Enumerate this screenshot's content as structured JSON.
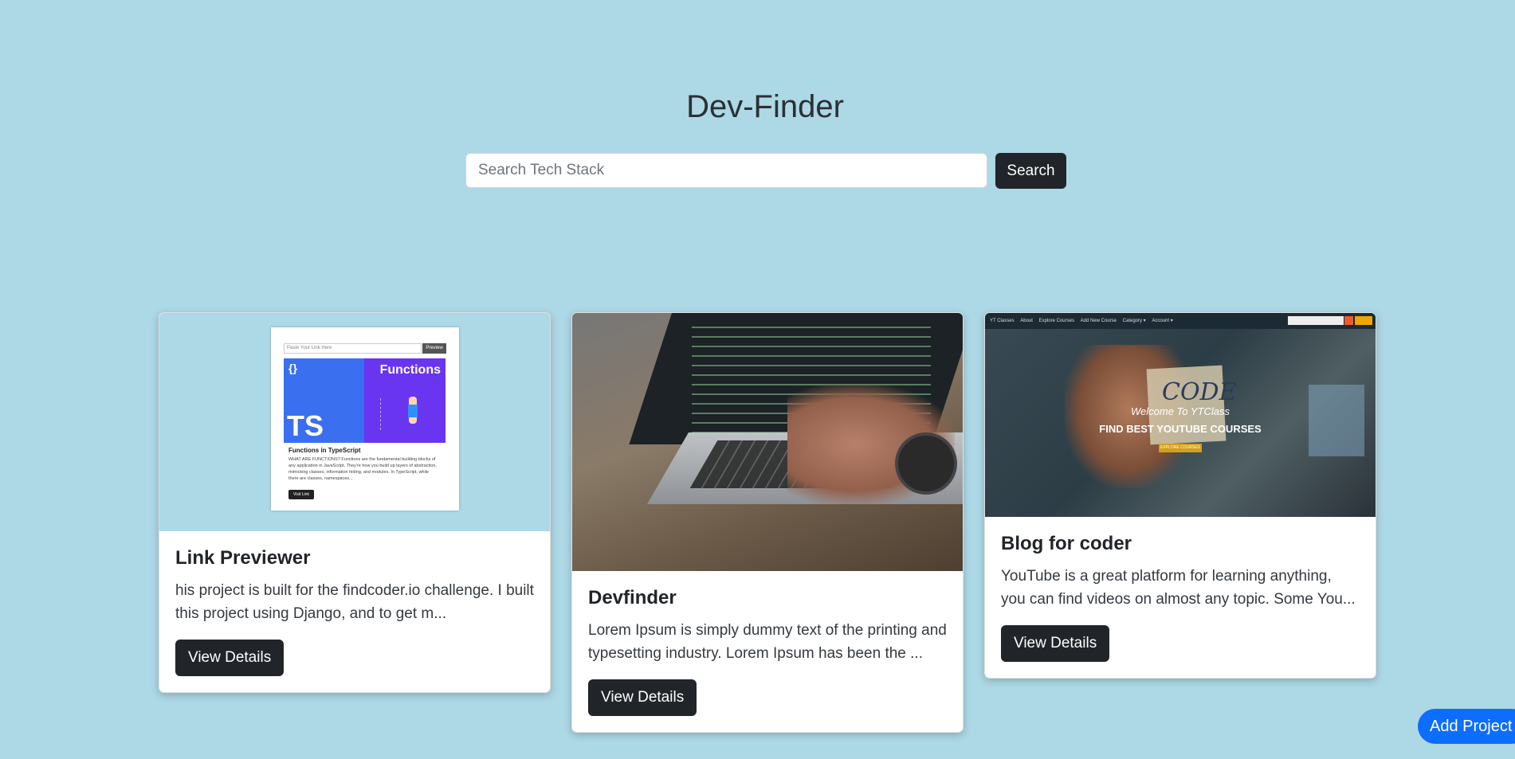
{
  "app": {
    "title": "Dev-Finder"
  },
  "search": {
    "placeholder": "Search Tech Stack",
    "value": "",
    "button_label": "Search"
  },
  "projects": [
    {
      "title": "Link Previewer",
      "description": "his project is built for the findcoder.io challenge. I built this project using Django, and to get m...",
      "button_label": "View Details",
      "thumbnail": {
        "input_placeholder": "Paste Your Link Here",
        "preview_label": "Preview",
        "banner_left": "TS",
        "banner_right": "Functions",
        "brace": "{}",
        "caption": "Functions in TypeScript",
        "description": "WHAT ARE FUNCTIONS? Functions are the fundamental building blocks of any application in JavaScript. They're how you build up layers of abstraction, mimicking classes, information hiding, and modules. In TypeScript, while there are classes, namespaces...",
        "visit_label": "Visit Link"
      }
    },
    {
      "title": "Devfinder",
      "description": "Lorem Ipsum is simply dummy text of the printing and typesetting industry. Lorem Ipsum has been the ...",
      "button_label": "View Details"
    },
    {
      "title": "Blog for coder",
      "description": "YouTube is a great platform for learning anything, you can find videos on almost any topic. Some You...",
      "button_label": "View Details",
      "thumbnail": {
        "brand": "YT Classes",
        "nav_items": [
          "About",
          "Explore Courses",
          "Add New Course",
          "Category ▾",
          "Account ▾"
        ],
        "search_placeholder": "Search",
        "profile_label": "Profile",
        "note_text": "CODE",
        "welcome": "Welcome To YTClass",
        "headline": "FIND BEST YOUTUBE COURSES",
        "cta": "EXPLORE COURSES"
      }
    }
  ],
  "add_project": {
    "label": "Add Project"
  },
  "colors": {
    "background": "#add8e6",
    "dark_button": "#212529",
    "accent_button": "#0d6efd"
  }
}
